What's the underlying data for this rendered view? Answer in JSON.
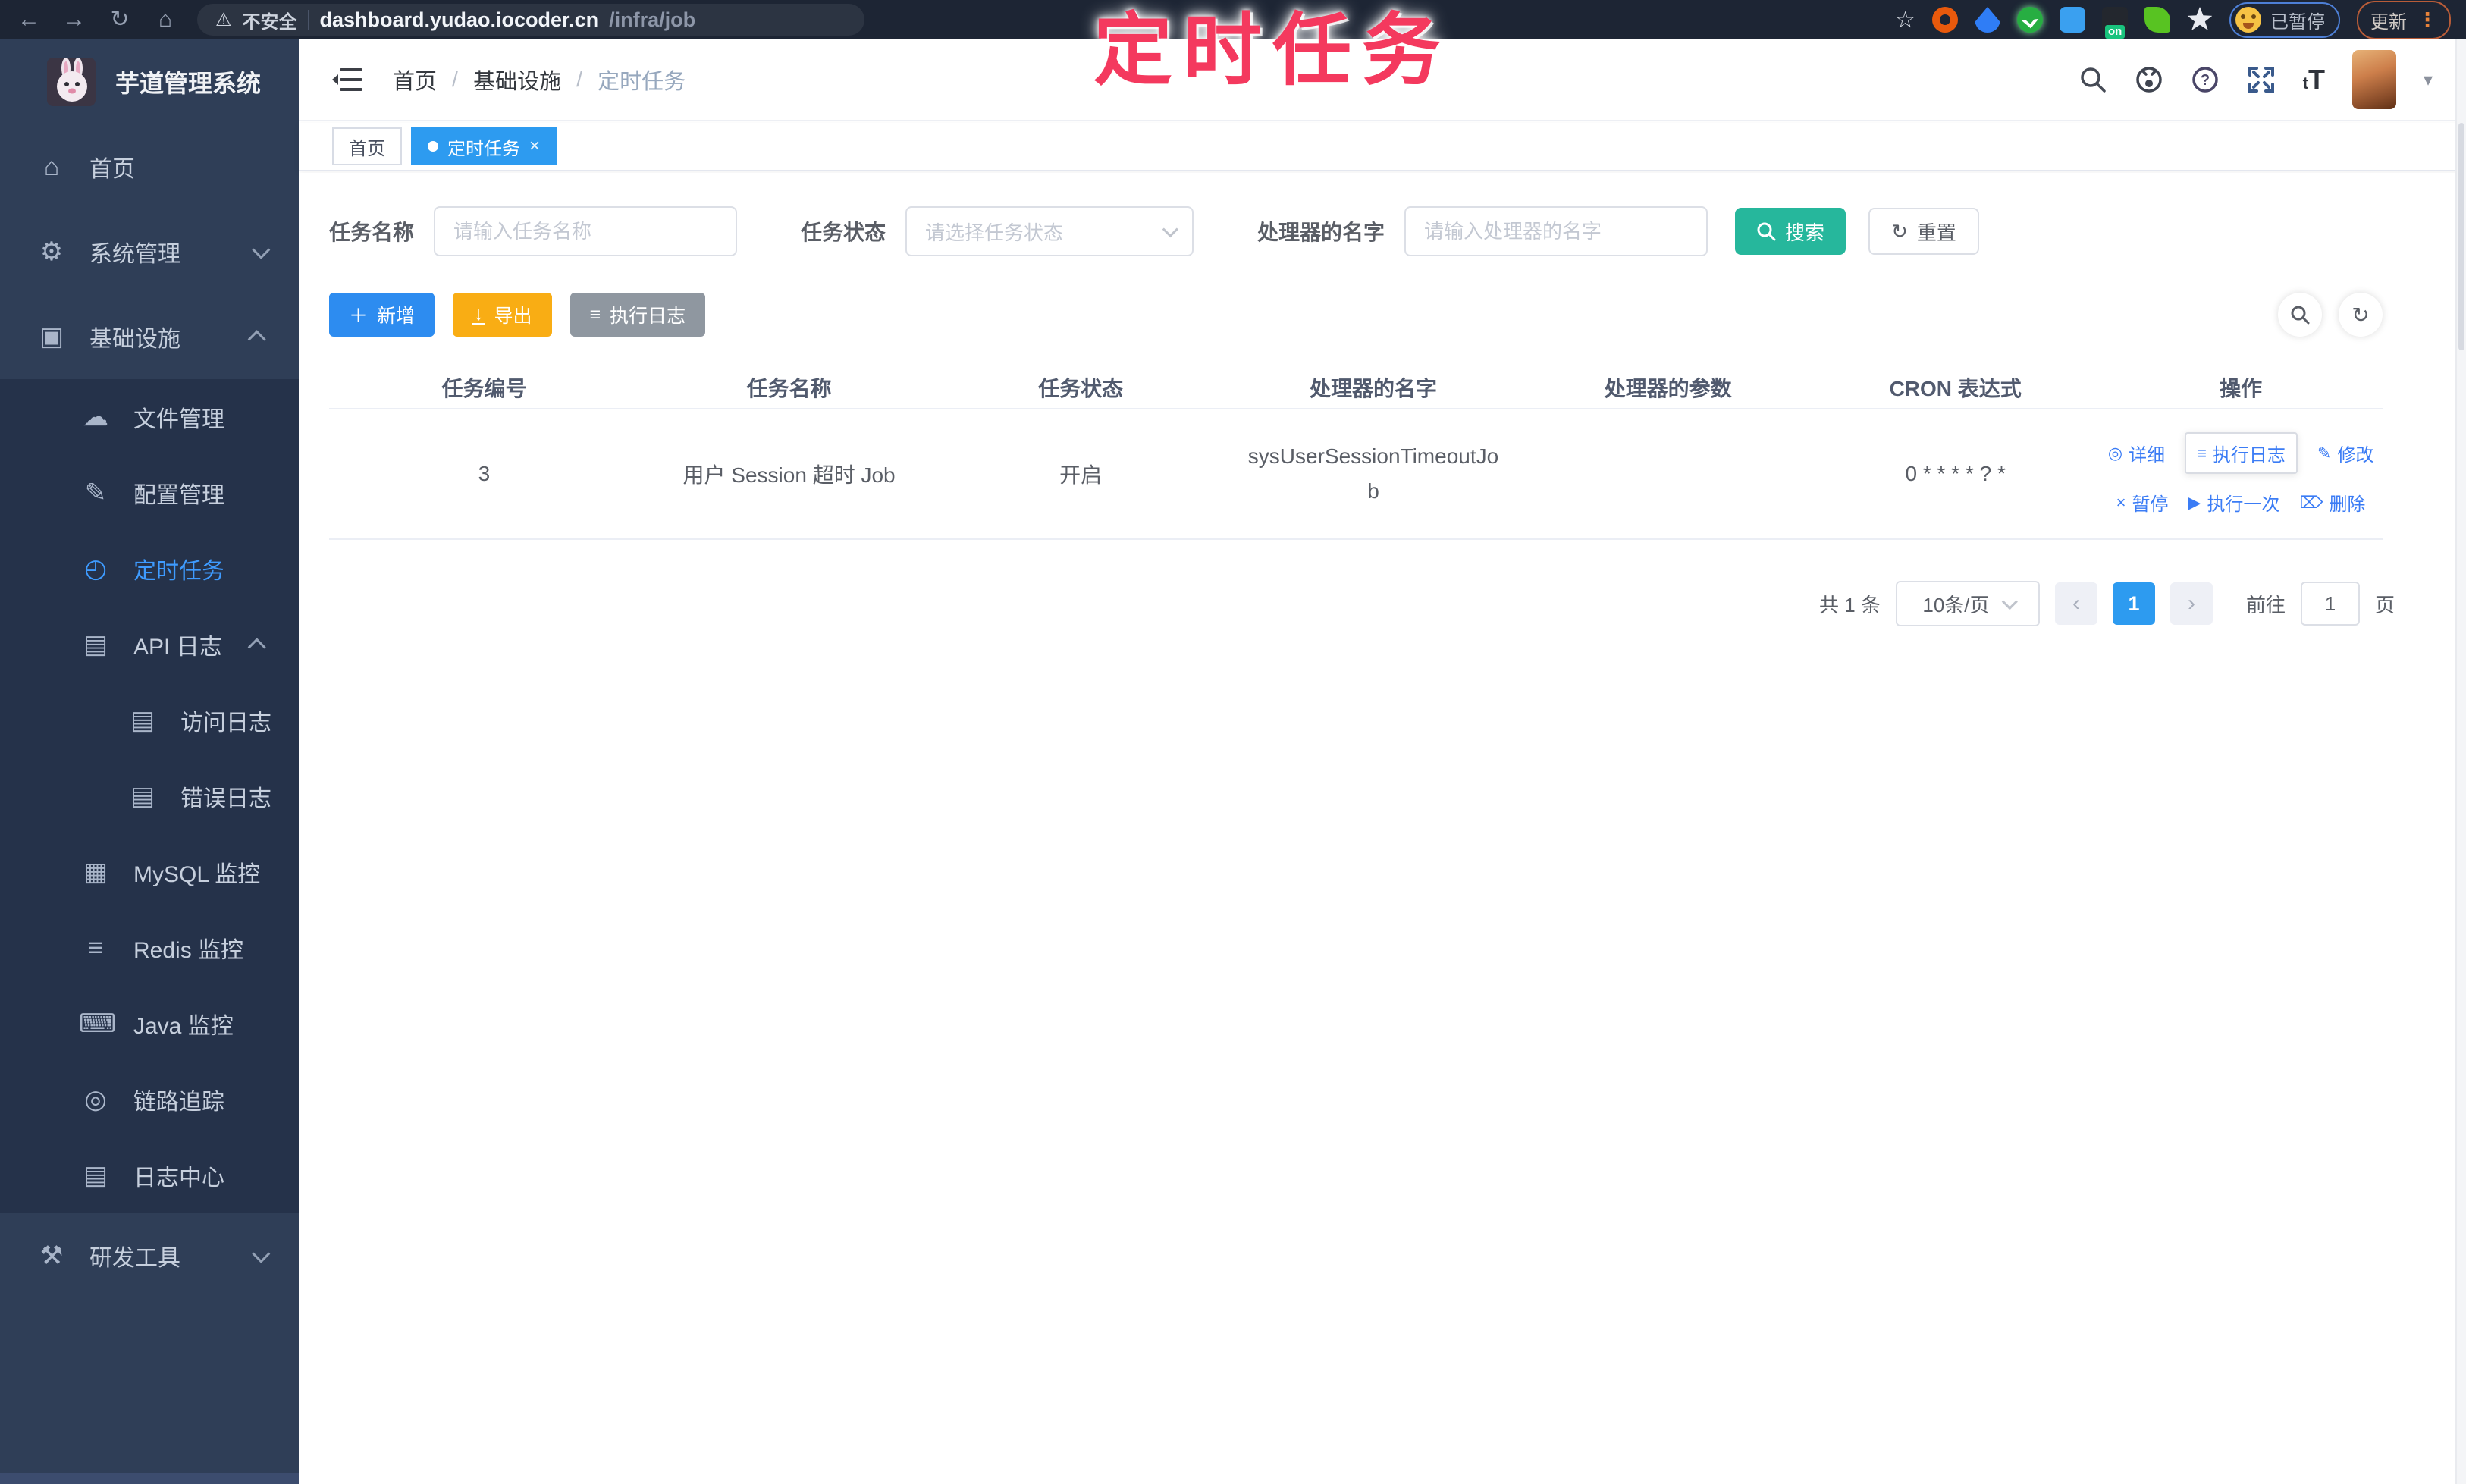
{
  "browser": {
    "security_label": "不安全",
    "url_domain": "dashboard.yudao.iocoder.cn",
    "url_path": "/infra/job",
    "paused_label": "已暂停",
    "update_label": "更新",
    "extension_badge": "on",
    "icons": {
      "back": "←",
      "forward": "→",
      "reload": "↻",
      "home": "⌂",
      "warning": "⚠",
      "star": "☆",
      "kebab": "⋮"
    }
  },
  "overlay": {
    "title": "定时任务"
  },
  "sidebar": {
    "logo_title": "芋道管理系统",
    "top_items": [
      {
        "label": "首页",
        "icon": "⌂"
      },
      {
        "label": "系统管理",
        "icon": "⚙"
      },
      {
        "label": "基础设施",
        "icon": "▣"
      }
    ],
    "infra_children": [
      {
        "label": "文件管理",
        "icon": "☁"
      },
      {
        "label": "配置管理",
        "icon": "✎"
      },
      {
        "label": "定时任务",
        "icon": "◴"
      },
      {
        "label": "API 日志",
        "icon": "▤"
      },
      {
        "label": "访问日志",
        "icon": "▤"
      },
      {
        "label": "错误日志",
        "icon": "▤"
      },
      {
        "label": "MySQL 监控",
        "icon": "▦"
      },
      {
        "label": "Redis 监控",
        "icon": "≡"
      },
      {
        "label": "Java 监控",
        "icon": "⌨"
      },
      {
        "label": "链路追踪",
        "icon": "◎"
      },
      {
        "label": "日志中心",
        "icon": "▤"
      }
    ],
    "dev_tools": {
      "label": "研发工具",
      "icon": "⚒"
    }
  },
  "header": {
    "breadcrumb": [
      "首页",
      "基础设施",
      "定时任务"
    ],
    "separator": "/"
  },
  "tags": {
    "home": "首页",
    "active": "定时任务",
    "close_icon": "×"
  },
  "filters": {
    "name_label": "任务名称",
    "name_placeholder": "请输入任务名称",
    "status_label": "任务状态",
    "status_placeholder": "请选择任务状态",
    "handler_label": "处理器的名字",
    "handler_placeholder": "请输入处理器的名字",
    "search_button": "搜索",
    "reset_button": "重置",
    "reset_icon": "↻"
  },
  "toolbar": {
    "add_button": "新增",
    "add_icon": "＋",
    "export_button": "导出",
    "export_icon": "↓",
    "log_button": "执行日志",
    "log_icon": "≡",
    "refresh_icon": "↻"
  },
  "table": {
    "headers": [
      "任务编号",
      "任务名称",
      "任务状态",
      "处理器的名字",
      "处理器的参数",
      "CRON 表达式",
      "操作"
    ],
    "row": {
      "id": "3",
      "name": "用户 Session 超时 Job",
      "status": "开启",
      "handler": "sysUserSessionTimeoutJob",
      "param": "",
      "cron": "0 * * * * ? *"
    },
    "actions": [
      {
        "label": "详细",
        "icon": "◎"
      },
      {
        "label": "执行日志",
        "icon": "≡"
      },
      {
        "label": "修改",
        "icon": "✎"
      },
      {
        "label": "暂停",
        "icon": "×"
      },
      {
        "label": "执行一次",
        "icon": "▶"
      },
      {
        "label": "删除",
        "icon": "⌦"
      }
    ]
  },
  "pagination": {
    "total": "共 1 条",
    "page_size": "10条/页",
    "prev_icon": "‹",
    "next_icon": "›",
    "current_page": "1",
    "goto_label": "前往",
    "goto_value": "1",
    "page_unit": "页"
  },
  "colors": {
    "accent_blue": "#409EFF",
    "teal": "#26b79c",
    "warning_orange": "#f9ad14",
    "info_gray": "#8f97a0",
    "overlay_pink": "#f4395e",
    "sidebar_bg": "#2f3e57",
    "submenu_bg": "#25324a"
  }
}
